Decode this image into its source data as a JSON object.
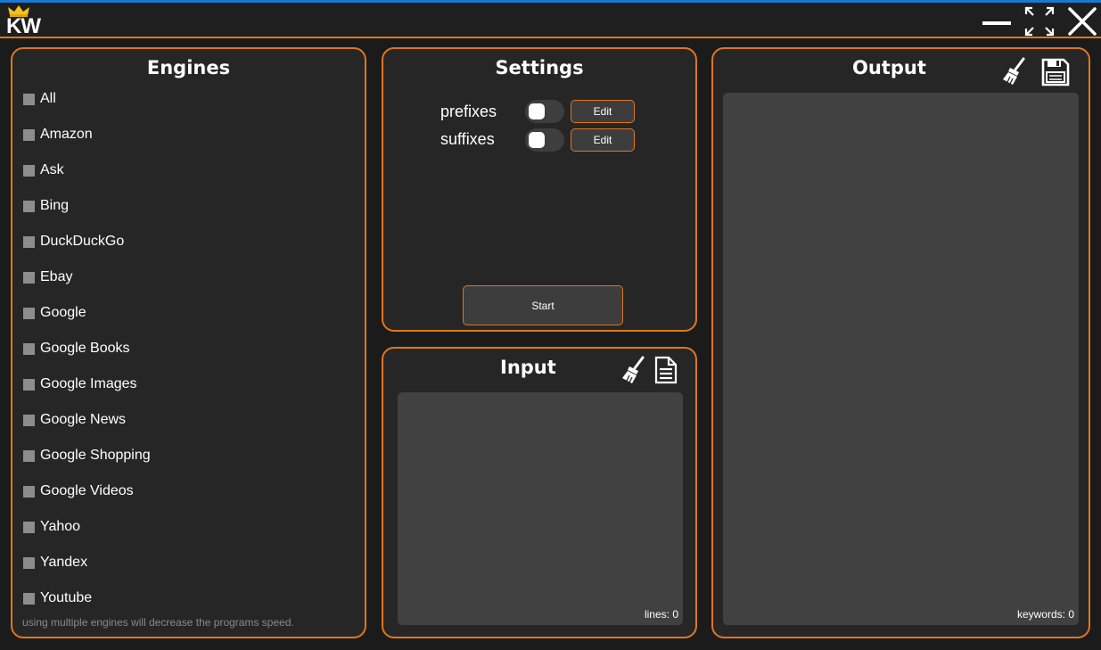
{
  "app": {
    "logo_text": "KW",
    "accent_color": "#e0761c",
    "window_controls": [
      "minimize-icon",
      "maximize-icon",
      "close-icon"
    ]
  },
  "engines": {
    "title": "Engines",
    "items": [
      {
        "label": "All"
      },
      {
        "label": "Amazon"
      },
      {
        "label": "Ask"
      },
      {
        "label": "Bing"
      },
      {
        "label": "DuckDuckGo"
      },
      {
        "label": "Ebay"
      },
      {
        "label": "Google"
      },
      {
        "label": "Google Books"
      },
      {
        "label": "Google Images"
      },
      {
        "label": "Google News"
      },
      {
        "label": "Google Shopping"
      },
      {
        "label": "Google Videos"
      },
      {
        "label": "Yahoo"
      },
      {
        "label": "Yandex"
      },
      {
        "label": "Youtube"
      }
    ],
    "note": "using multiple engines will decrease the programs speed."
  },
  "settings": {
    "title": "Settings",
    "prefixes_label": "prefixes",
    "suffixes_label": "suffixes",
    "edit_label": "Edit",
    "start_label": "Start"
  },
  "input": {
    "title": "Input",
    "counter": "lines: 0",
    "icons": [
      "broom-icon",
      "document-icon"
    ]
  },
  "output": {
    "title": "Output",
    "counter": "keywords: 0",
    "icons": [
      "broom-icon",
      "save-icon"
    ]
  }
}
